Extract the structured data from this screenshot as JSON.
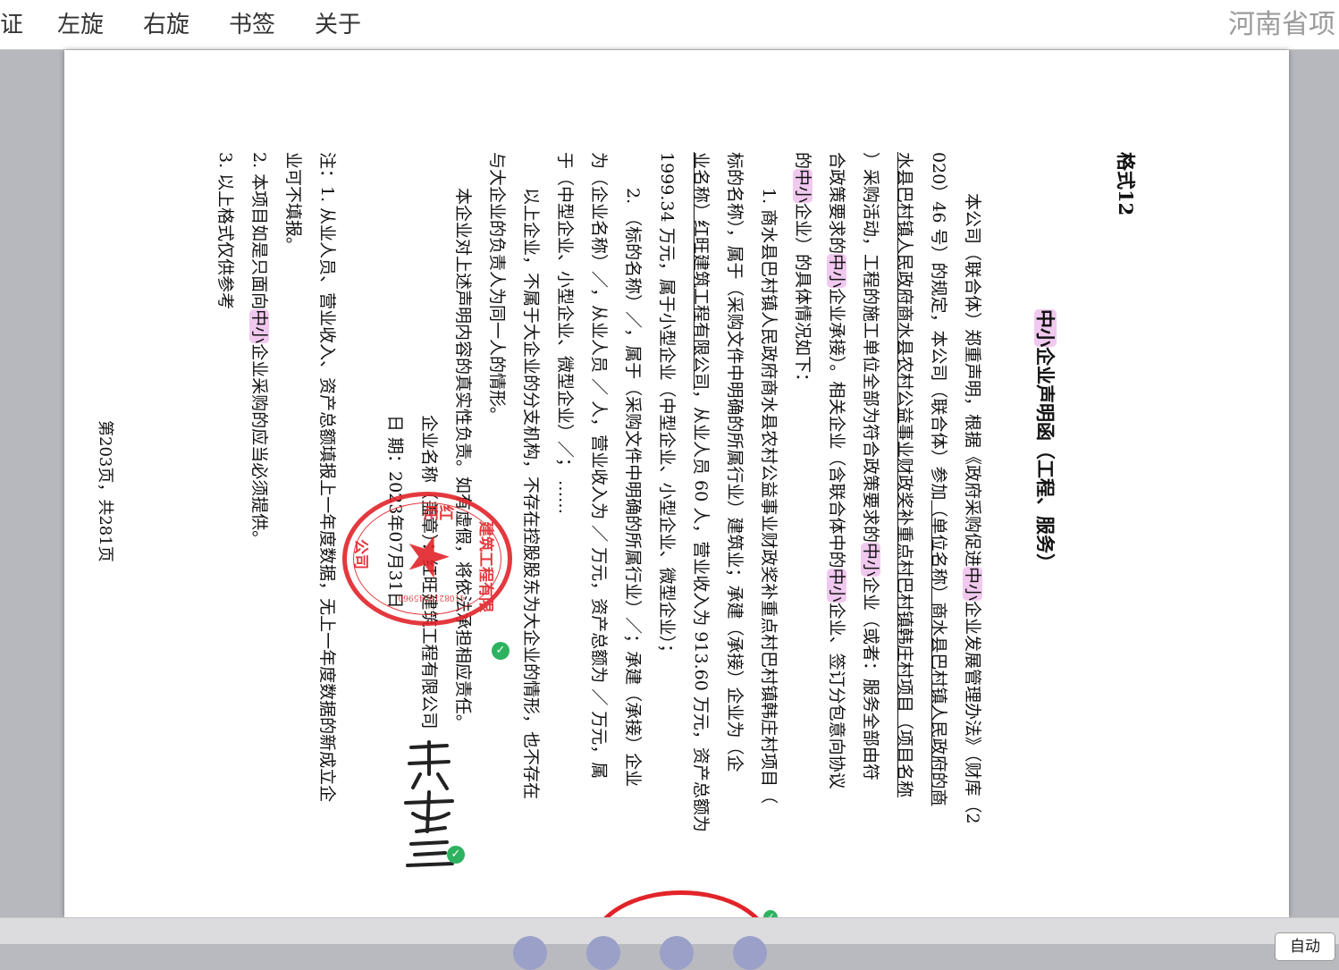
{
  "toolbar": {
    "items": [
      "证",
      "左旋",
      "右旋",
      "书签",
      "关于"
    ],
    "brand": "河南省项"
  },
  "doc": {
    "format": "格式12",
    "title_a": "中小",
    "title_b": "企业声明函（工程、服务）",
    "l1a": "本公司（联合体）郑重声明，根据《政府采购促进",
    "l1b": "中小",
    "l1c": "企业发展管理办法》（财库（2",
    "l2a": "020）46 号）的规定，本公司（联合体）参加",
    "l2b": "（单位名称）商水县巴村镇人民政府的商",
    "l3": "水县巴村镇人民政府商水县农村公益事业财政奖补重点村巴村镇韩庄村项目（项目名称",
    "l4a": "）采购活动，工程的施工单位全部为符合政策要求的",
    "l4b": "中小",
    "l4c": "企业（或者：服务全部由符",
    "l5a": "合政策要求的",
    "l5b": "中小",
    "l5c": "企业承接）。相关企业（含联合体中的",
    "l5d": "中小",
    "l5e": "企业、签订分包意向协议",
    "l6a": "的",
    "l6b": "中小",
    "l6c": "企业）的具体情况如下：",
    "l7": "1. 商水县巴村镇人民政府商水县农村公益事业财政奖补重点村巴村镇韩庄村项目（",
    "l8a": "标的名称）",
    "l8b": "，属于（采购文件中明确的所属行业）建筑业；承建（承接）企业为（企",
    "l9a": "业名称）红旺建筑工程有限公司",
    "l9b": "，从业人员 60 人，营业收入为 913.60 万元，资产总额为",
    "l10": "1999.34 万元，属于小型企业（中型企业、小型企业、微型企业）；",
    "l11": "2. （标的名称）／，属于（采购文件中明确的所属行业）／；承建（承接）企业",
    "l12": "为（企业名称）／，从业人员 ／ 人，营业收入为 ／ 万元，资产总额为 ／ 万元，属",
    "l13": "于（中型企业、小型企业、微型企业）／；  ……",
    "l14": "以上企业，不属于大企业的分支机构，不存在控股股东为大企业的情形，也不存在",
    "l15": "与大企业的负责人为同一人的情形。",
    "l16": "本企业对上述声明内容的真实性负责。如有虚假，将依法承担相应责任。",
    "l17": "企业名称（盖章）：红旺建筑工程有限公司",
    "l18": "日 期：2023年07月31日",
    "l19a": "注：1. 从业人员、营业收入、资产总额填报上一年度数据，无上一年度数据的新成立企",
    "l19b": "业可不填报。",
    "l20a": "2. 本项目如是只面向",
    "l20b": "中小",
    "l20c": "企业采购的应当必须提供。",
    "l21": "3. 以上格式仅供参考",
    "footer": "第203页，共281页"
  },
  "stamp": {
    "top": "建筑工程有限",
    "side": "红旺",
    "bottom": "公司",
    "number": "4108210045960"
  },
  "signature": "郭秀兰",
  "bottom_bar": {
    "auto_label": "自动"
  },
  "colors": {
    "highlight": "#f1c9ef",
    "stamp": "#e1242a",
    "check": "#2db360"
  }
}
